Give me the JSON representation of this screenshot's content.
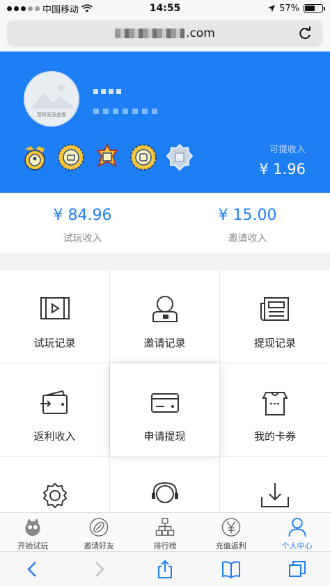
{
  "status_bar": {
    "carrier": "中国移动",
    "time": "14:55",
    "battery": "57%",
    "battery_level": 0.57
  },
  "browser": {
    "url_visible_part": ".com",
    "url_masked": true
  },
  "profile": {
    "avatar_caption": "暂时无法查看",
    "username_masked": true,
    "badges": [
      "badge-1-icon",
      "badge-2-icon",
      "badge-3-icon",
      "badge-4-icon",
      "badge-5-icon"
    ],
    "withdrawable_label": "可提收入",
    "withdrawable_value": "¥ 1.96"
  },
  "income": {
    "trial": {
      "value": "¥ 84.96",
      "label": "试玩收入"
    },
    "invite": {
      "value": "¥ 15.00",
      "label": "邀请收入"
    }
  },
  "grid": [
    {
      "label": "试玩记录",
      "icon": "video-icon"
    },
    {
      "label": "邀请记录",
      "icon": "user-invite-icon"
    },
    {
      "label": "提现记录",
      "icon": "newspaper-icon"
    },
    {
      "label": "返利收入",
      "icon": "wallet-icon"
    },
    {
      "label": "申请提现",
      "icon": "card-icon"
    },
    {
      "label": "我的卡券",
      "icon": "coupon-icon"
    },
    {
      "label": "",
      "icon": "gear-icon"
    },
    {
      "label": "",
      "icon": "headset-icon"
    },
    {
      "label": "",
      "icon": "download-tray-icon"
    }
  ],
  "tabs": [
    {
      "label": "开始试玩",
      "icon": "mascot-icon"
    },
    {
      "label": "邀请好友",
      "icon": "football-icon"
    },
    {
      "label": "排行榜",
      "icon": "hierarchy-icon"
    },
    {
      "label": "充值返利",
      "icon": "yen-icon"
    },
    {
      "label": "个人中心",
      "icon": "person-icon",
      "active": true
    }
  ],
  "colors": {
    "brand": "#1e7ff5",
    "text": "#222222",
    "muted": "#888888"
  }
}
